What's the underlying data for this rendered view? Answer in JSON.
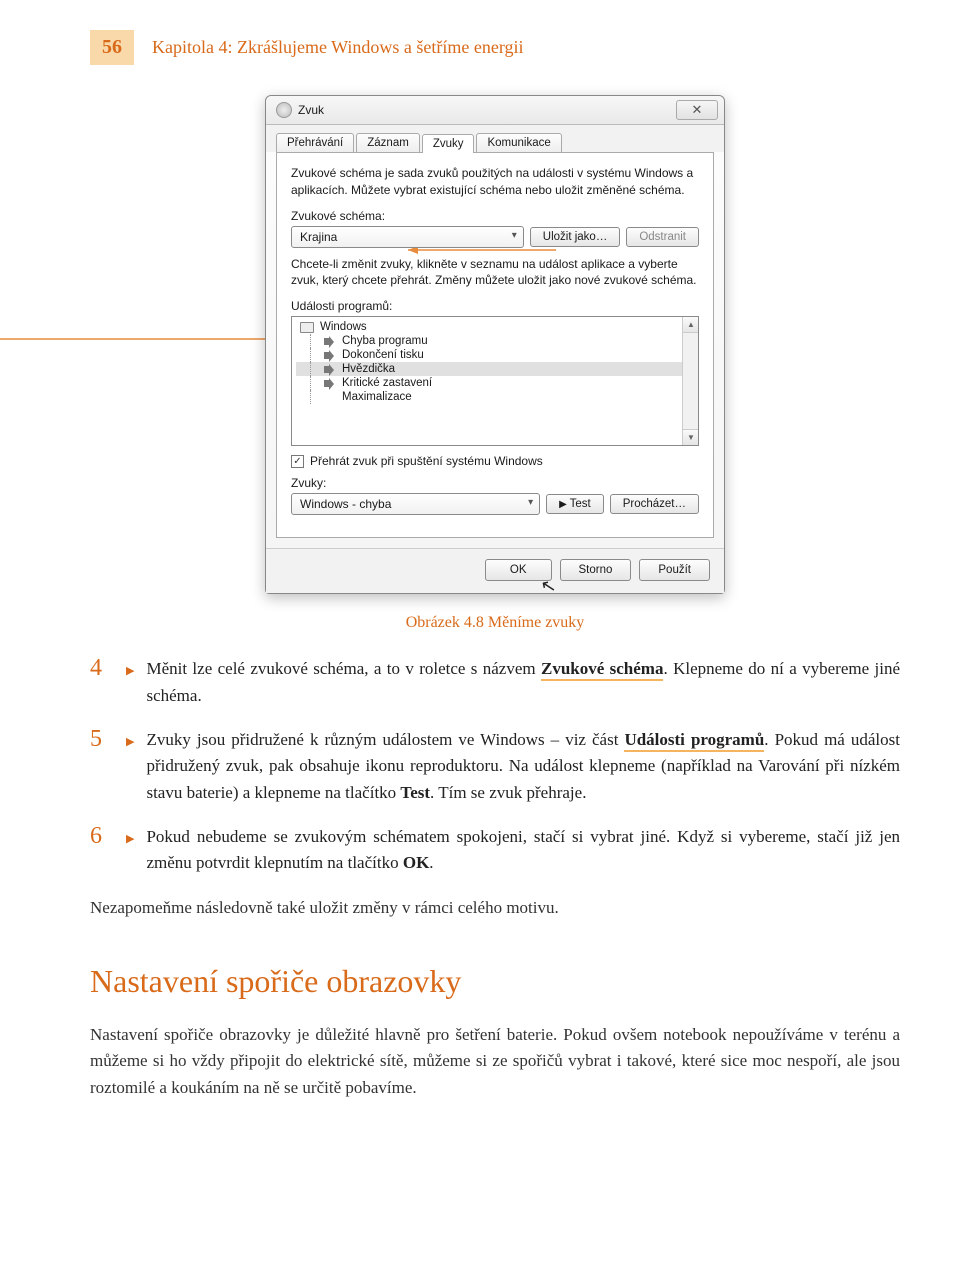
{
  "header": {
    "page_number": "56",
    "chapter_label": "Kapitola 4:",
    "chapter_title": "Zkrášlujeme Windows a šetříme energii"
  },
  "dialog": {
    "title": "Zvuk",
    "tabs": [
      "Přehrávání",
      "Záznam",
      "Zvuky",
      "Komunikace"
    ],
    "active_tab_index": 2,
    "desc1": "Zvukové schéma je sada zvuků použitých na události v systému Windows a aplikacích. Můžete vybrat existující schéma nebo uložit změněné schéma.",
    "scheme_label": "Zvukové schéma:",
    "scheme_value": "Krajina",
    "save_as": "Uložit jako…",
    "delete": "Odstranit",
    "desc2": "Chcete-li změnit zvuky, klikněte v seznamu na událost aplikace a vyberte zvuk, který chcete přehrát. Změny můžete uložit jako nové zvukové schéma.",
    "events_label": "Události programů:",
    "events": [
      {
        "label": "Windows",
        "root": true
      },
      {
        "label": "Chyba programu",
        "speaker": true
      },
      {
        "label": "Dokončení tisku",
        "speaker": true
      },
      {
        "label": "Hvězdička",
        "speaker": true,
        "selected": true
      },
      {
        "label": "Kritické zastavení",
        "speaker": true
      },
      {
        "label": "Maximalizace",
        "speaker": false
      }
    ],
    "play_startup": "Přehrát zvuk při spuštění systému Windows",
    "sounds_label": "Zvuky:",
    "sounds_value": "Windows - chyba",
    "test": "Test",
    "browse": "Procházet…",
    "ok": "OK",
    "cancel": "Storno",
    "apply": "Použít"
  },
  "caption": {
    "label": "Obrázek 4.8",
    "text": "Měníme zvuky"
  },
  "steps": {
    "s4a": "Měnit lze celé zvukové schéma, a to v roletce s názvem ",
    "s4_u": "Zvukové schéma",
    "s4b": ". Klepneme do ní a vybereme jiné schéma.",
    "s5a": "Zvuky jsou přidružené k různým událostem ve Windows – viz část ",
    "s5_u": "Události programů",
    "s5b": ". Pokud má událost přidružený zvuk, pak obsahuje ikonu reproduktoru. Na událost klepneme (například na Varování při nízkém stavu baterie) a klepneme na tlačítko ",
    "s5_bold": "Test",
    "s5c": ". Tím se zvuk přehraje.",
    "s6a": "Pokud nebudeme se zvukovým schématem spokojeni, stačí si vybrat jiné. Když si vybereme, stačí již jen změnu potvrdit klepnutím na tlačítko ",
    "s6_bold": "OK",
    "s6b": ".",
    "closing": "Nezapomeňme následovně také uložit změny v rámci celého motivu."
  },
  "section": {
    "title": "Nastavení spořiče obrazovky",
    "para": "Nastavení spořiče obrazovky je důležité hlavně pro šetření baterie. Pokud ovšem notebook nepoužíváme v terénu a můžeme si ho vždy připojit do elektrické sítě, můžeme si ze spořičů vybrat i takové, které sice moc nespoří, ale jsou roztomilé a koukáním na ně se určitě pobavíme."
  }
}
